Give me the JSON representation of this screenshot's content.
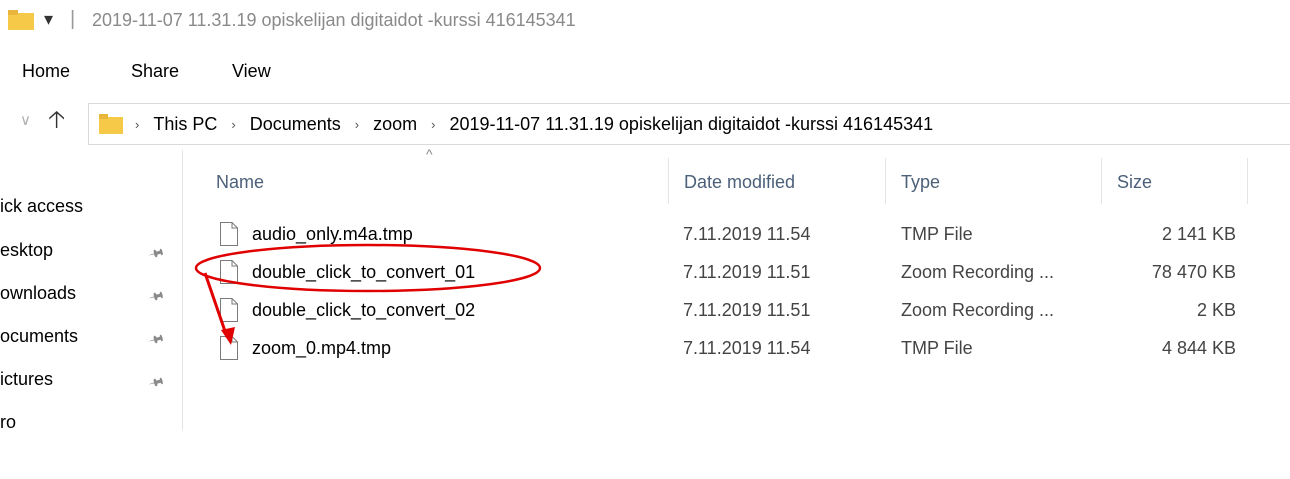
{
  "window": {
    "title": "2019-11-07 11.31.19 opiskelijan digitaidot -kurssi 416145341",
    "quick_access_dropdown": "▾",
    "title_separator": "|"
  },
  "ribbon": {
    "tabs": [
      "Home",
      "Share",
      "View"
    ]
  },
  "address_bar": {
    "back_icon": "chevron-down-icon",
    "up_icon": "arrow-up-icon",
    "breadcrumbs": [
      "This PC",
      "Documents",
      "zoom",
      "2019-11-07 11.31.19 opiskelijan digitaidot -kurssi 416145341"
    ],
    "separator": "›"
  },
  "nav_pane": {
    "items": [
      "ick access",
      "esktop",
      "ownloads",
      "ocuments",
      "ictures",
      "ro"
    ]
  },
  "columns": {
    "sort_indicator": "^",
    "name": "Name",
    "date": "Date modified",
    "type": "Type",
    "size": "Size"
  },
  "files": [
    {
      "name": "audio_only.m4a.tmp",
      "date": "7.11.2019 11.54",
      "type": "TMP File",
      "size": "2 141 KB"
    },
    {
      "name": "double_click_to_convert_01",
      "date": "7.11.2019 11.51",
      "type": "Zoom Recording ...",
      "size": "78 470 KB"
    },
    {
      "name": "double_click_to_convert_02",
      "date": "7.11.2019 11.51",
      "type": "Zoom Recording ...",
      "size": "2 KB"
    },
    {
      "name": "zoom_0.mp4.tmp",
      "date": "7.11.2019 11.54",
      "type": "TMP File",
      "size": "4 844 KB"
    }
  ],
  "annotation": {
    "color": "#e00000",
    "highlighted_file": "double_click_to_convert_01",
    "arrow_target": "zoom_0.mp4.tmp"
  },
  "colors": {
    "folder": "#f7c948",
    "header_text": "#4c607a",
    "annotation_red": "#e00000"
  }
}
